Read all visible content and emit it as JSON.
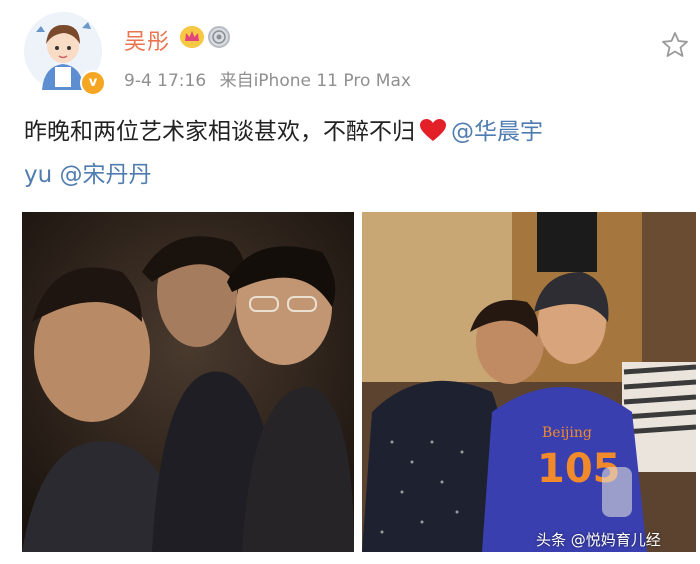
{
  "post": {
    "author": "吴彤",
    "time": "9-4 17:16",
    "source": "来自iPhone 11 Pro Max",
    "verified_badge": "v",
    "text_main": "昨晚和两位艺术家相谈甚欢，不醉不归",
    "mentions": [
      "@华晨宇",
      "yu",
      "@宋丹丹"
    ],
    "icons": [
      "avatar-icon",
      "crown-icon",
      "medal-icon",
      "star-icon",
      "heart-icon"
    ]
  },
  "watermark": "头条 @悦妈育儿经"
}
